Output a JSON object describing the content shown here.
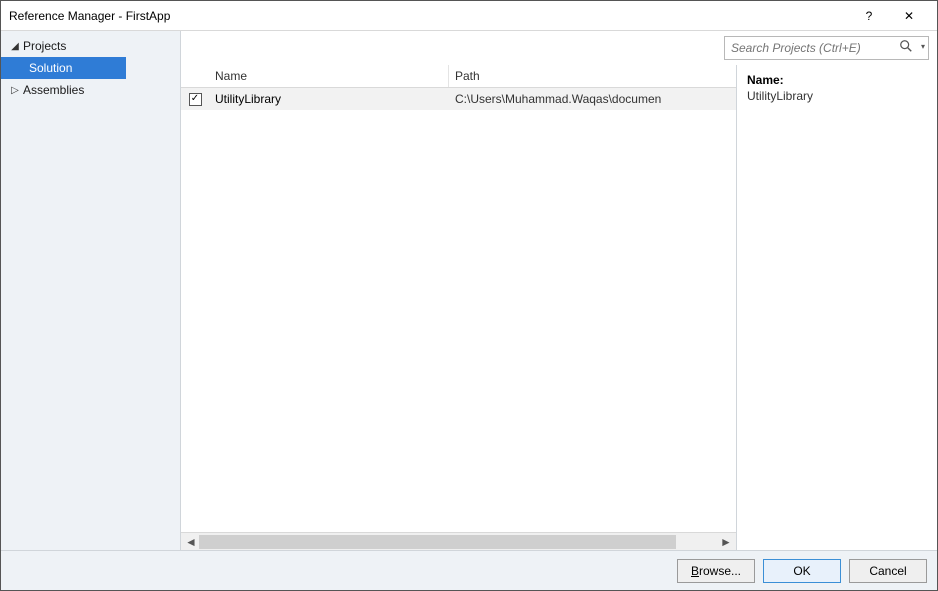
{
  "window": {
    "title": "Reference Manager - FirstApp",
    "help_icon_label": "?",
    "close_icon_label": "✕"
  },
  "sidebar": {
    "items": [
      {
        "label": "Projects",
        "expanded": true,
        "children": [
          {
            "label": "Solution",
            "selected": true
          }
        ]
      },
      {
        "label": "Assemblies",
        "expanded": false
      }
    ]
  },
  "search": {
    "placeholder": "Search Projects (Ctrl+E)"
  },
  "list": {
    "columns": {
      "name": "Name",
      "path": "Path"
    },
    "rows": [
      {
        "checked": true,
        "name": "UtilityLibrary",
        "path": "C:\\Users\\Muhammad.Waqas\\documen"
      }
    ]
  },
  "info": {
    "name_label": "Name:",
    "name_value": "UtilityLibrary"
  },
  "footer": {
    "browse_prefix": "B",
    "browse_rest": "rowse...",
    "ok": "OK",
    "cancel": "Cancel"
  }
}
